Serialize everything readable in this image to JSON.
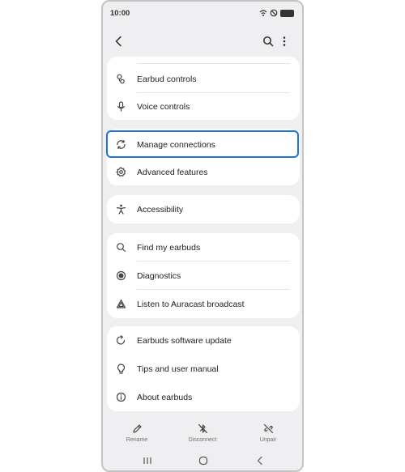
{
  "status_bar": {
    "time": "10:00"
  },
  "menu": {
    "group1": {
      "earbud_controls": "Earbud controls",
      "voice_controls": "Voice controls"
    },
    "group2": {
      "manage_connections": "Manage connections",
      "advanced_features": "Advanced features"
    },
    "group3": {
      "accessibility": "Accessibility"
    },
    "group4": {
      "find_my_earbuds": "Find my earbuds",
      "diagnostics": "Diagnostics",
      "auracast": "Listen to Auracast broadcast"
    },
    "group5": {
      "software_update": "Earbuds software update",
      "tips_manual": "Tips and user manual",
      "about": "About earbuds"
    }
  },
  "bottom_bar": {
    "rename": "Rename",
    "disconnect": "Disconnect",
    "unpair": "Unpair"
  },
  "highlighted_item": "Manage connections",
  "colors": {
    "highlight": "#1e73d8",
    "background": "#efeff1",
    "card": "#ffffff"
  }
}
